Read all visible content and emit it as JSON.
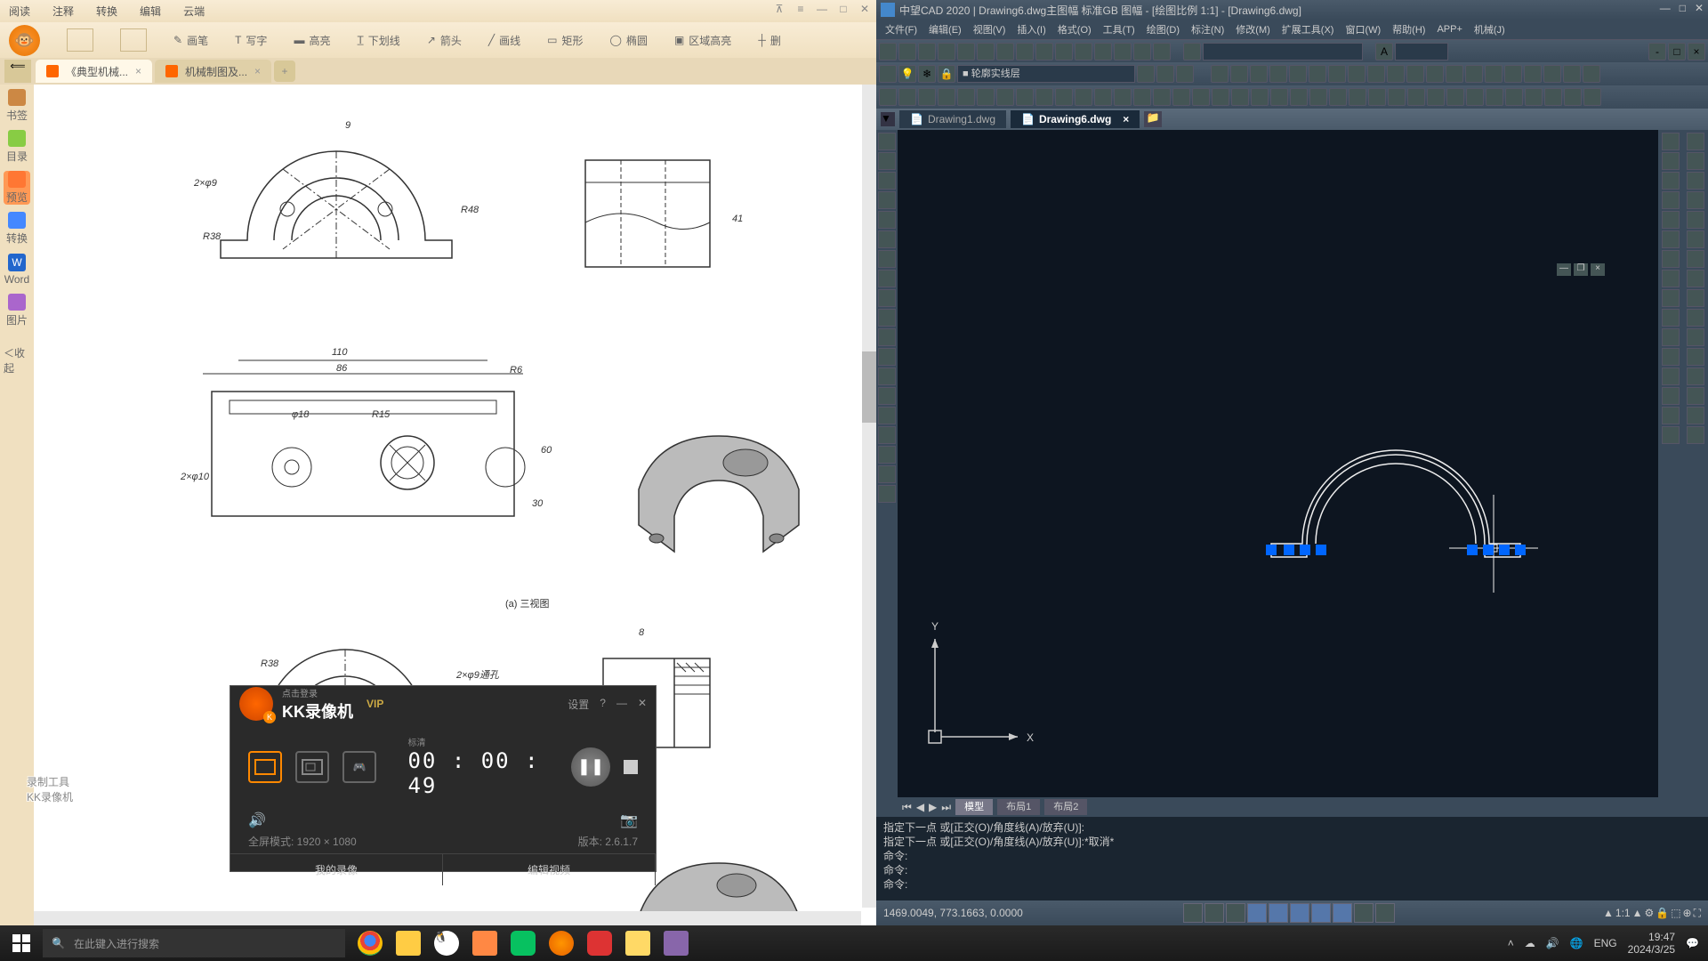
{
  "pdf": {
    "menu": {
      "read": "阅读",
      "note": "注释",
      "convert": "转换",
      "edit": "编辑",
      "cloud": "云端"
    },
    "tools": {
      "pen": "画笔",
      "text": "写字",
      "highlight": "高亮",
      "underline": "下划线",
      "arrow": "箭头",
      "line": "画线",
      "rect": "矩形",
      "ellipse": "椭圆",
      "area": "区域高亮",
      "strike": "删"
    },
    "tabs": {
      "t1": "《典型机械...",
      "t2": "机械制图及...",
      "add": "+"
    },
    "sidebar": {
      "bookmark": "书签",
      "toc": "目录",
      "preview": "预览",
      "convert": "转换",
      "word": "Word",
      "image": "图片",
      "collapse": "＜收起"
    },
    "drawing": {
      "d1": "2×φ9",
      "d2": "9",
      "d3": "R38",
      "d4": "R48",
      "d5": "41",
      "d6": "110",
      "d7": "86",
      "d8": "R6",
      "d9": "φ18",
      "d10": "R15",
      "d11": "60",
      "d12": "30",
      "d13": "2×φ10",
      "d14": "(a) 三视图",
      "d15": "R38",
      "d16": "2×φ9通孔",
      "d17": "R48",
      "d18": "8"
    }
  },
  "cad": {
    "title": "中望CAD 2020 | Drawing6.dwg主图幅  标准GB 图幅 - [绘图比例 1:1] - [Drawing6.dwg]",
    "menu": {
      "file": "文件(F)",
      "edit": "编辑(E)",
      "view": "视图(V)",
      "insert": "插入(I)",
      "format": "格式(O)",
      "tools": "工具(T)",
      "draw": "绘图(D)",
      "dim": "标注(N)",
      "modify": "修改(M)",
      "ext": "扩展工具(X)",
      "window": "窗口(W)",
      "help": "帮助(H)",
      "app": "APP+",
      "mech": "机械(J)"
    },
    "layer": "■ 轮廓实线层",
    "filetabs": {
      "t1": "Drawing1.dwg",
      "t2": "Drawing6.dwg"
    },
    "btabs": {
      "model": "模型",
      "layout1": "布局1",
      "layout2": "布局2"
    },
    "cmd": {
      "l1": "指定下一点  或[正交(O)/角度线(A)/放弃(U)]:",
      "l2": "指定下一点  或[正交(O)/角度线(A)/放弃(U)]:*取消*",
      "l3": "命令:",
      "l4": "命令:",
      "l5": "命令: "
    },
    "coords": "1469.0049, 773.1663, 0.0000",
    "scale": "1:1"
  },
  "kk": {
    "login": "点击登录",
    "title": "KK录像机",
    "vip": "VIP",
    "settings": "设置",
    "timerLabel": "标清",
    "timer": "00 : 00 : 49",
    "fullscreen": "全屏模式: 1920 × 1080",
    "version": "版本: 2.6.1.7",
    "myrecord": "我的录像",
    "editvideo": "编辑视频"
  },
  "watermark": {
    "l1": "录制工具",
    "l2": "KK录像机"
  },
  "taskbar": {
    "search": "在此键入进行搜索",
    "lang": "ENG",
    "time": "19:47",
    "date": "2024/3/25"
  }
}
